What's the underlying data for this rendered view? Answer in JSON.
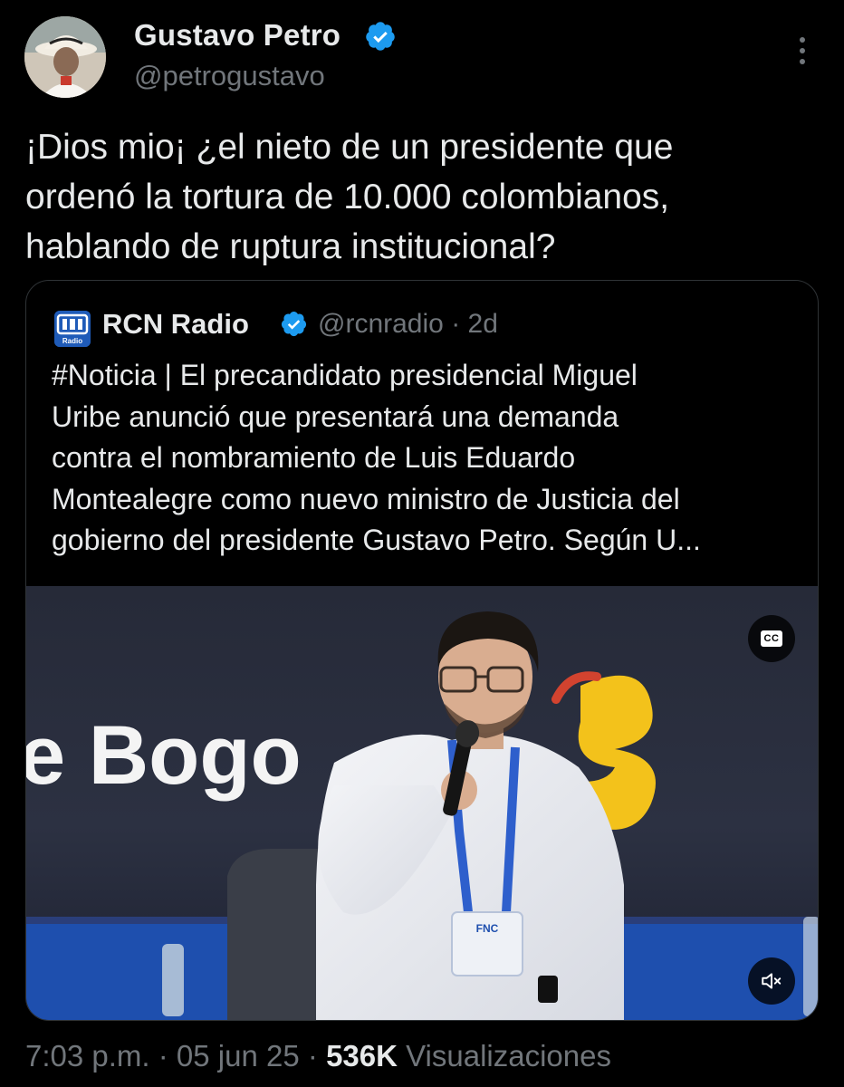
{
  "author": {
    "display_name": "Gustavo Petro",
    "handle": "@petrogustavo",
    "verified": true
  },
  "tweet": {
    "lines": [
      "¡Dios mio¡ ¿el nieto de un presidente que",
      "ordenó la tortura de 10.000 colombianos,",
      "hablando de ruptura institucional?"
    ]
  },
  "quoted": {
    "display_name": "RCN Radio",
    "handle": "@rcnradio",
    "separator": "·",
    "time": "2d",
    "verified": true,
    "logo_label": "Radio",
    "lines": [
      "#Noticia | El precandidato presidencial Miguel",
      "Uribe anunció que presentará una demanda",
      "contra el nombramiento de Luis Eduardo",
      "Montealegre como nuevo ministro de Justicia del",
      "gobierno del presidente Gustavo Petro. Según U..."
    ],
    "video": {
      "cc_label": "CC",
      "background_text": "e Bogo",
      "badge_text": "FNC",
      "muted": true
    }
  },
  "meta": {
    "time": "7:03 p.m.",
    "separator": "·",
    "date": "05 jun 25",
    "views_count": "536K",
    "views_label": "Visualizaciones"
  },
  "colors": {
    "background": "#000000",
    "text_primary": "#e7e9ea",
    "text_secondary": "#71767b",
    "border": "#2f3336",
    "verified_blue": "#1d9bf0"
  },
  "icons": {
    "verified": "verified-badge-icon",
    "more": "more-icon",
    "cc": "closed-captions-icon",
    "mute": "volume-muted-icon"
  }
}
